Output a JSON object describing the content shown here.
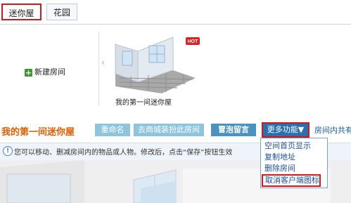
{
  "tabs": [
    {
      "label": "迷你屋"
    },
    {
      "label": "花园"
    }
  ],
  "gallery": {
    "new_room_label": "新建房间",
    "prev_arrow": "‹",
    "thumbnail_caption": "我的第一间迷你屋",
    "hot_badge": "HOT"
  },
  "room": {
    "title": "我的第一间迷你屋",
    "buttons": {
      "rename": "重命名",
      "shop": "去商城装扮此房间",
      "bubble": "冒泡留言",
      "more": "更多功能▼"
    },
    "room_count_text": "房间内共有"
  },
  "info": {
    "icon": "!",
    "text": "您可以移动、删减房间内的物品或人物。修改后，点击“保存”按钮生效"
  },
  "menu": {
    "items": [
      {
        "label": "空间首页显示"
      },
      {
        "label": "复制地址"
      },
      {
        "label": "删除房间"
      },
      {
        "label": "取消客户端图标"
      }
    ]
  },
  "colors": {
    "accent_orange": "#e05d00",
    "highlight_red": "#d0191b",
    "button_light": "#8ec4dc",
    "button_dark": "#2a6fb0"
  }
}
